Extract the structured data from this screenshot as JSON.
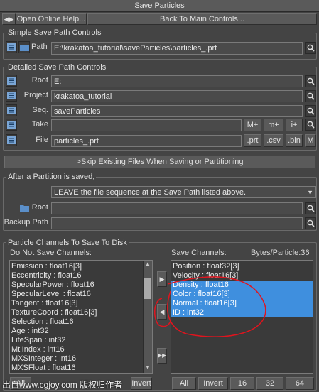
{
  "title": "Save Particles",
  "toolbar": {
    "open_help": "Open Online Help...",
    "back_main": "Back To Main Controls..."
  },
  "simple": {
    "group_label": "Simple Save Path Controls",
    "path_label": "Path",
    "path_value": "E:\\krakatoa_tutorial\\saveParticles\\particles_.prt"
  },
  "detailed": {
    "group_label": "Detailed Save Path Controls",
    "root_label": "Root",
    "root_value": "E:",
    "project_label": "Project",
    "project_value": "krakatoa_tutorial",
    "seq_label": "Seq.",
    "seq_value": "saveParticles",
    "take_label": "Take",
    "take_value": "",
    "file_label": "File",
    "file_value": "particles_.prt",
    "take_buttons": [
      "M+",
      "m+",
      "i+"
    ],
    "file_buttons": [
      ".prt",
      ".csv",
      ".bin",
      "M"
    ]
  },
  "skip_label": ">Skip Existing Files When Saving or Partitioning",
  "partition": {
    "group_label": "After a Partition is saved,",
    "dropdown_value": "LEAVE the file sequence at the Save Path listed above.",
    "root_label": "Root",
    "root_value": "",
    "backup_label": "Backup Path",
    "backup_value": ""
  },
  "channels": {
    "group_label": "Particle Channels To Save To Disk",
    "dont_save_label": "Do Not Save Channels:",
    "save_label": "Save Channels:",
    "bytes_label": "Bytes/Particle:36",
    "dont_save": [
      "Emission  :  float16[3]",
      "Eccentricity  :  float16",
      "SpecularPower  :  float16",
      "SpecularLevel  :  float16",
      "Tangent  :  float16[3]",
      "TextureCoord  :  float16[3]",
      "Selection  :  float16",
      "Age  :  int32",
      "LifeSpan  :  int32",
      "MtlIndex  :  int16",
      "MXSInteger  :  int16",
      "MXSFloat  :  float16"
    ],
    "save": [
      "Position  :  float32[3]",
      "Velocity  :  float16[3]",
      "Density  :  float16",
      "Color  :  float16[3]",
      "Normal  :  float16[3]",
      "ID  :  int32"
    ],
    "selected_save": [
      2,
      3,
      4,
      5
    ],
    "left_buttons": [
      "All",
      "Invert"
    ],
    "right_buttons": [
      "All",
      "Invert",
      "16",
      "32",
      "64"
    ]
  },
  "watermark": "出自www.cgjoy.com 版权归作者",
  "colors": {
    "selection": "#3f8fde",
    "annotation": "#e0141e"
  }
}
